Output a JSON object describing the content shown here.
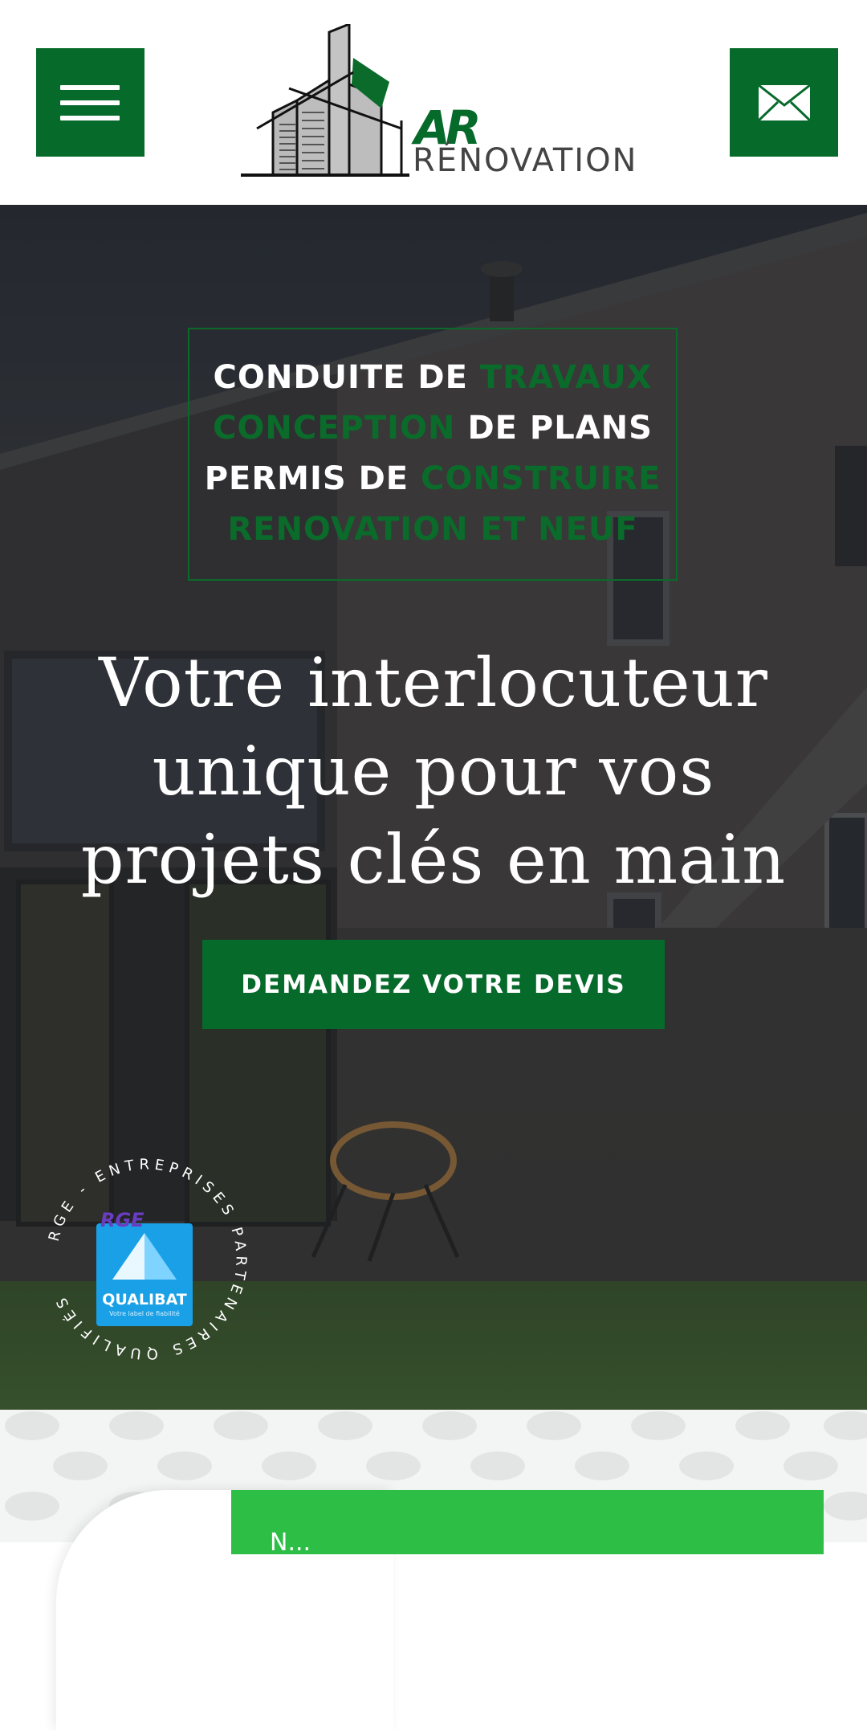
{
  "header": {
    "logo_mark": "AR",
    "logo_name": "RÉNOVATION",
    "icons": {
      "menu": "hamburger-menu-icon",
      "mail": "envelope-icon"
    }
  },
  "hero": {
    "services": {
      "line1": {
        "white": "CONDUITE DE",
        "green": "TRAVAUX"
      },
      "line2": {
        "green": "CONCEPTION",
        "white": "DE PLANS"
      },
      "line3": {
        "white": "PERMIS DE",
        "green": "CONSTRUIRE"
      },
      "line4": {
        "green": "RENOVATION ET NEUF"
      }
    },
    "headline": "Votre interlocuteur unique pour vos projets clés en main",
    "cta_label": "DEMANDEZ VOTRE DEVIS",
    "badge": {
      "ring_text": "RGE - ENTREPRISES PARTENAIRES QUALIFIÉS",
      "rge": "RGE",
      "qualibat": "QUALIBAT",
      "tagline": "Votre label de fiabilité"
    }
  },
  "next_section": {
    "card_text": "N..."
  },
  "colors": {
    "brand_green": "#066a2b",
    "bright_green": "#2dbf45",
    "text_white": "#ffffff"
  }
}
